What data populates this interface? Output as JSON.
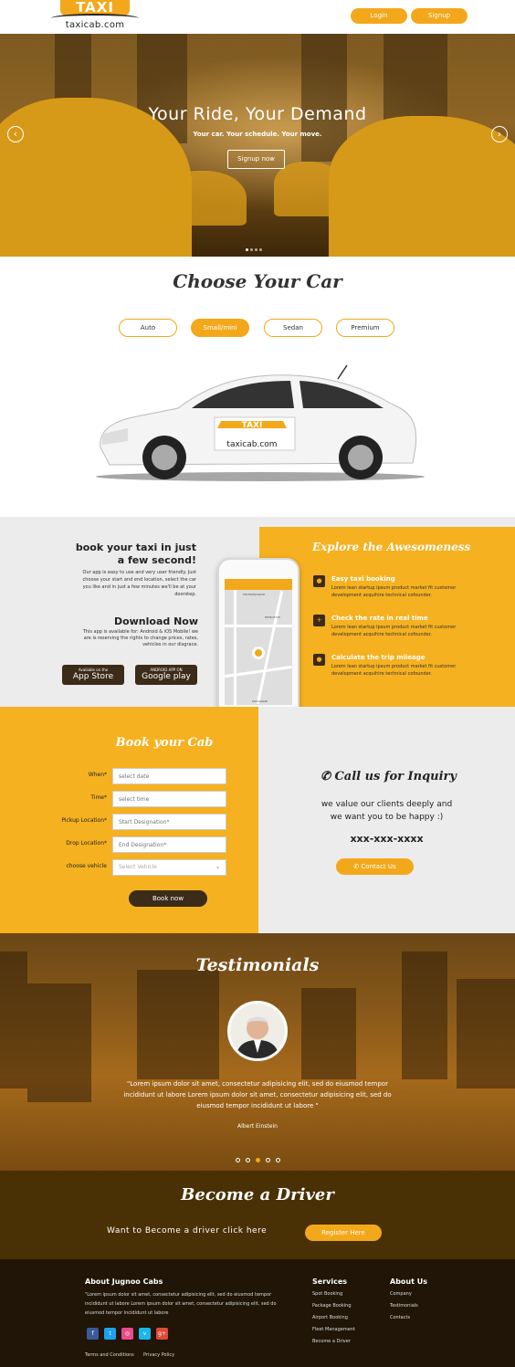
{
  "header": {
    "logo_badge": "TAXI",
    "logo_domain": "taxicab.com",
    "login_label": "Login",
    "signup_label": "Signup"
  },
  "hero": {
    "title": "Your Ride, Your Demand",
    "subtitle": "Your car. Your schedule. Your move.",
    "signup_label": "Signup now",
    "prev_icon": "chevron-left-icon",
    "next_icon": "chevron-right-icon",
    "slide_count": 4,
    "active_slide": 1
  },
  "choose": {
    "title": "Choose Your Car",
    "tabs": [
      {
        "label": "Auto",
        "active": false
      },
      {
        "label": "Small/mini",
        "active": true
      },
      {
        "label": "Sedan",
        "active": false
      },
      {
        "label": "Premium",
        "active": false
      }
    ],
    "car_badge": "TAXI",
    "car_domain": "taxicab.com"
  },
  "app": {
    "title_line1": "book your taxi in just",
    "title_line2": "a few second!",
    "description": "Our app is easy to use and very user friendly. Just choose your start and end location, select the car you like and in just a few minutes we'll be at your doorstep.",
    "download_title": "Download Now",
    "download_desc": "This app is available for: Android & iOS Mobile! we are is reserving the rights to change prices, rates, vehicles in our disgrace.",
    "appstore_small": "Available on the",
    "appstore_big": "App Store",
    "googleplay_small": "ANDROID APP ON",
    "googleplay_big": "Google play",
    "map_labels": [
      "MISTRZEJOWICE",
      "BIENCZYCE",
      "PODGORZE"
    ]
  },
  "explore": {
    "title": "Explore the Awesomeness",
    "features": [
      {
        "icon": "location-pin-icon",
        "title": "Easy taxi booking",
        "text": "Lorem lean startup ipsum product market fit customer development acquihire technical cofounder."
      },
      {
        "icon": "plus-icon",
        "title": "Check the rate in real time",
        "text": "Lorem lean startup ipsum product market fit customer development acquihire technical cofounder."
      },
      {
        "icon": "location-pin-icon",
        "title": "Calculate the trip mileage",
        "text": "Lorem lean startup ipsum product market fit customer development acquihire technical cofounder."
      }
    ]
  },
  "booking": {
    "title": "Book your Cab",
    "fields": [
      {
        "label": "When*",
        "placeholder": "select date"
      },
      {
        "label": "Time*",
        "placeholder": "select time"
      },
      {
        "label": "Pickup Location*",
        "placeholder": "Start Designation*"
      },
      {
        "label": "Drop Location*",
        "placeholder": "End Designation*"
      },
      {
        "label": "choose vehicle",
        "placeholder": "Select Vehicle"
      }
    ],
    "submit_label": "Book now"
  },
  "inquiry": {
    "title": "Call us for Inquiry",
    "line1": "we value our clients deeply and",
    "line2": "we want you to be happy :)",
    "phone": "xxx-xxx-xxxx",
    "contact_label": "Contact Us"
  },
  "testimonials": {
    "title": "Testimonials",
    "quote": "\"Lorem ipsum dolor sit amet, consectetur adipisicing elit, sed do eiusmod tempor incididunt ut labore  Lorem ipsum dolor sit amet, consectetur adipisicing elit, sed do eiusmod tempor  incididunt ut labore \"",
    "author": "Albert Einstein",
    "dot_count": 5,
    "active_dot": 3
  },
  "driver": {
    "title": "Become a Driver",
    "subtitle": "Want to Become a driver click here",
    "register_label": "Register Here"
  },
  "footer": {
    "about_title": "About Jugnoo Cabs",
    "about_text": "\"Lorem ipsum dolor sit amet, consectetur adipisicing elit, sed do eiusmod tempor  incididunt ut labore  Lorem ipsum dolor sit amet, consectetur adipisicing elit, sed do eiusmod tempor  incididunt ut labore",
    "social": [
      {
        "icon": "facebook-icon",
        "glyph": "f",
        "color": "#3b5998"
      },
      {
        "icon": "twitter-icon",
        "glyph": "t",
        "color": "#1da1f2"
      },
      {
        "icon": "dribbble-icon",
        "glyph": "◎",
        "color": "#ea4c89"
      },
      {
        "icon": "vimeo-icon",
        "glyph": "v",
        "color": "#1ab7ea"
      },
      {
        "icon": "google-plus-icon",
        "glyph": "g+",
        "color": "#dd4b39"
      }
    ],
    "terms_label": "Terms and Conditions",
    "privacy_label": "Privacy Policy",
    "services_title": "Services",
    "services": [
      "Spot Booking",
      "Package Booking",
      "Airport Booking",
      "Fleet Management",
      "Become a Driver"
    ],
    "about_us_title": "About Us",
    "about_links": [
      "Company",
      "Testimonials",
      "Contacts"
    ]
  }
}
